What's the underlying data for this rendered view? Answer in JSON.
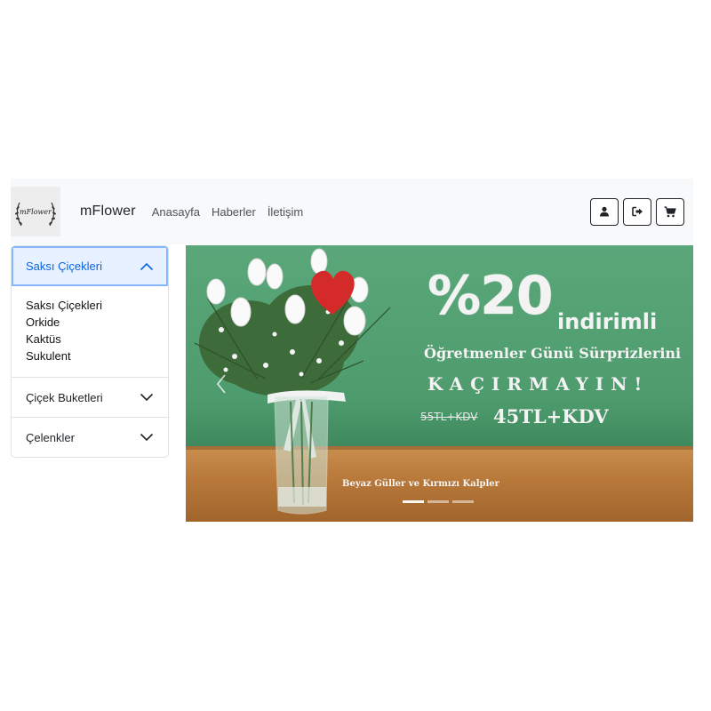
{
  "navbar": {
    "logo_text": "mFlower",
    "brand": "mFlower",
    "links": [
      {
        "label": "Anasayfa"
      },
      {
        "label": "Haberler"
      },
      {
        "label": "İletişim"
      }
    ],
    "actions": [
      {
        "icon": "user-icon"
      },
      {
        "icon": "sign-out-icon"
      },
      {
        "icon": "shopping-cart-icon"
      }
    ]
  },
  "sidebar": {
    "sections": [
      {
        "title": "Saksı Çiçekleri",
        "expanded": true,
        "items": [
          "Saksı Çiçekleri",
          "Orkide",
          "Kaktüs",
          "Sukulent"
        ]
      },
      {
        "title": "Çiçek Buketleri",
        "expanded": false,
        "items": []
      },
      {
        "title": "Çelenkler",
        "expanded": false,
        "items": []
      }
    ]
  },
  "carousel": {
    "slide": {
      "percent": "%20",
      "indirimli": "indirimli",
      "line2": "Öğretmenler Günü Sürprizlerini",
      "line3": "KAÇIRMAYIN!",
      "old_price": "55TL+KDV",
      "new_price": "45TL+KDV",
      "caption": "Beyaz Güller ve Kırmızı Kalpler"
    },
    "indicator_count": 3,
    "active_index": 0
  },
  "colors": {
    "navbar_bg": "#f8f9fa",
    "accordion_active_bg": "#e7f1ff",
    "accordion_active_text": "#0c63e4",
    "slide_green": "#4e9c6e",
    "table_wood": "#b8783a"
  }
}
